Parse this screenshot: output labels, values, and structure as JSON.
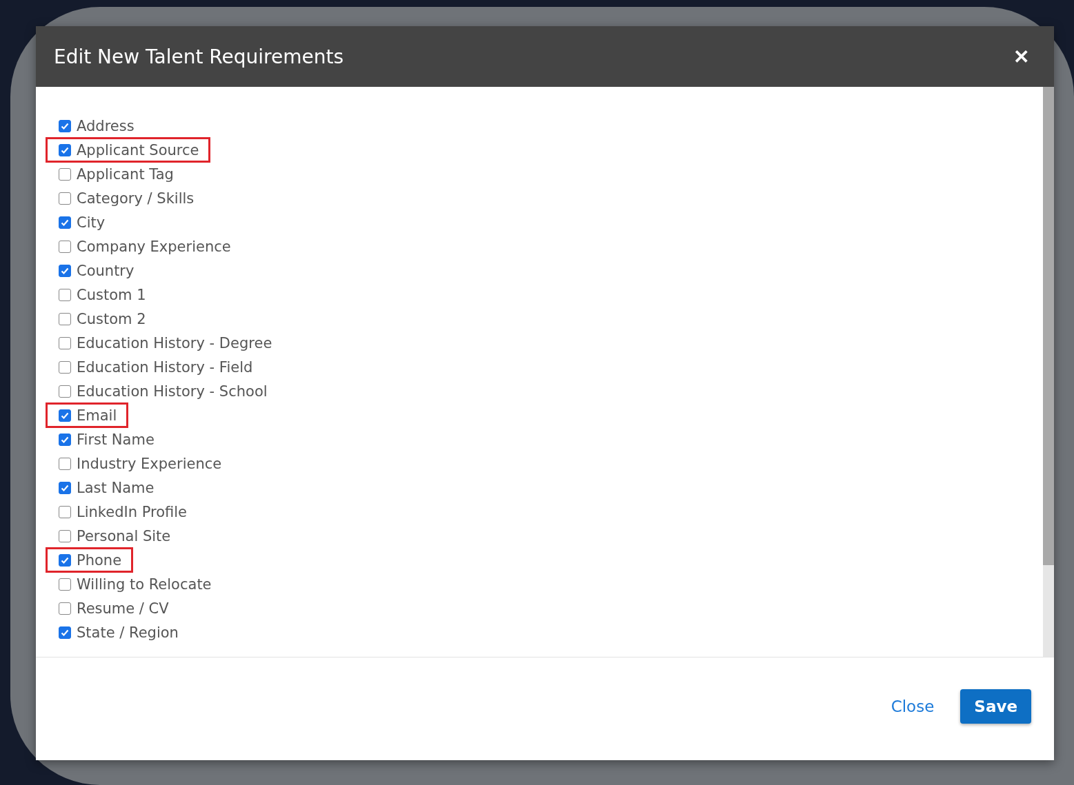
{
  "dialog": {
    "title": "Edit New Talent Requirements",
    "close_icon": "✕"
  },
  "fields": [
    {
      "label": "Address",
      "checked": true,
      "highlighted": false
    },
    {
      "label": "Applicant Source",
      "checked": true,
      "highlighted": true
    },
    {
      "label": "Applicant Tag",
      "checked": false,
      "highlighted": false
    },
    {
      "label": "Category / Skills",
      "checked": false,
      "highlighted": false
    },
    {
      "label": "City",
      "checked": true,
      "highlighted": false
    },
    {
      "label": "Company Experience",
      "checked": false,
      "highlighted": false
    },
    {
      "label": "Country",
      "checked": true,
      "highlighted": false
    },
    {
      "label": "Custom 1",
      "checked": false,
      "highlighted": false
    },
    {
      "label": "Custom 2",
      "checked": false,
      "highlighted": false
    },
    {
      "label": "Education History - Degree",
      "checked": false,
      "highlighted": false
    },
    {
      "label": "Education History - Field",
      "checked": false,
      "highlighted": false
    },
    {
      "label": "Education History - School",
      "checked": false,
      "highlighted": false
    },
    {
      "label": "Email",
      "checked": true,
      "highlighted": true
    },
    {
      "label": "First Name",
      "checked": true,
      "highlighted": false
    },
    {
      "label": "Industry Experience",
      "checked": false,
      "highlighted": false
    },
    {
      "label": "Last Name",
      "checked": true,
      "highlighted": false
    },
    {
      "label": "LinkedIn Profile",
      "checked": false,
      "highlighted": false
    },
    {
      "label": "Personal Site",
      "checked": false,
      "highlighted": false
    },
    {
      "label": "Phone",
      "checked": true,
      "highlighted": true
    },
    {
      "label": "Willing to Relocate",
      "checked": false,
      "highlighted": false
    },
    {
      "label": "Resume / CV",
      "checked": false,
      "highlighted": false
    },
    {
      "label": "State / Region",
      "checked": true,
      "highlighted": false
    }
  ],
  "footer": {
    "close": "Close",
    "save": "Save"
  }
}
